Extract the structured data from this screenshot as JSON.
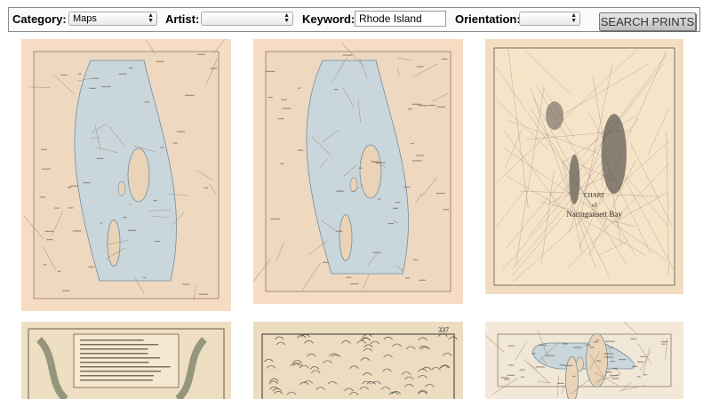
{
  "filters": {
    "category": {
      "label": "Category:",
      "value": "Maps"
    },
    "artist": {
      "label": "Artist:",
      "value": ""
    },
    "keyword": {
      "label": "Keyword:",
      "value": "Rhode Island"
    },
    "orientation": {
      "label": "Orientation:",
      "value": ""
    },
    "search_button": "SEARCH PRINTS"
  },
  "prints": [
    {
      "name": "print-thumbnail-1",
      "paper": "#f7dcc4",
      "style": "topo"
    },
    {
      "name": "print-thumbnail-2",
      "paper": "#f7dcc4",
      "style": "topo"
    },
    {
      "name": "print-thumbnail-3",
      "paper": "#f3ddc0",
      "style": "chart",
      "cartouche": [
        "CHART",
        "of",
        "Narragansett Bay"
      ]
    },
    {
      "name": "print-thumbnail-4",
      "paper": "#eedfc3",
      "style": "antique"
    },
    {
      "name": "print-thumbnail-5",
      "paper": "#ecdcc0",
      "style": "engraving",
      "plate_number": "337"
    },
    {
      "name": "print-thumbnail-6",
      "paper": "#f4e9d8",
      "style": "topo-light"
    }
  ],
  "icons": [
    "select-arrows-icon"
  ]
}
